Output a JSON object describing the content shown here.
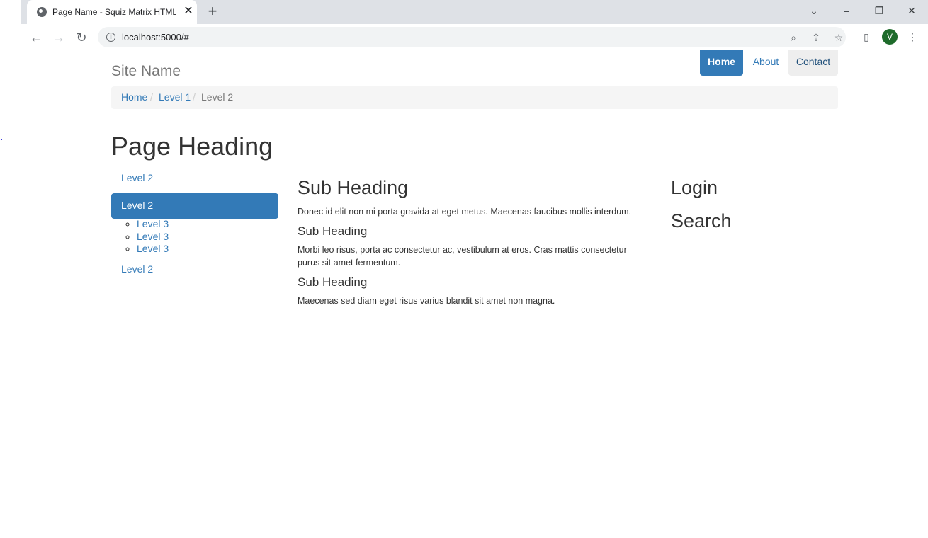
{
  "browser": {
    "tab_title": "Page Name - Squiz Matrix HTML",
    "tab_close": "✕",
    "new_tab": "+",
    "url": "localhost:5000/#",
    "avatar_letter": "V",
    "controls": {
      "dropdown": "⌄",
      "minimize": "–",
      "restore": "❐",
      "close": "✕"
    },
    "icons": {
      "back": "←",
      "forward": "→",
      "reload": "↻",
      "info": "i",
      "zoom": "⌕",
      "share": "⇪",
      "bookmark": "☆",
      "side_panel": "▯",
      "menu": "⋮"
    },
    "avatar_color": "#1e6b2b"
  },
  "site": {
    "name": "Site Name",
    "nav": [
      "Home",
      "About",
      "Contact"
    ]
  },
  "breadcrumb": {
    "items": [
      "Home",
      "Level 1",
      "Level 2"
    ],
    "separator": "/"
  },
  "page": {
    "heading": "Page Heading"
  },
  "sidenav": {
    "items": [
      "Level 2",
      "Level 2",
      "Level 2"
    ],
    "sub_items": [
      "Level 3",
      "Level 3",
      "Level 3"
    ]
  },
  "main": {
    "heading": "Sub Heading",
    "intro": "Donec id elit non mi porta gravida at eget metus. Maecenas faucibus mollis interdum.",
    "sections": [
      {
        "heading": "Sub Heading",
        "text_line1": "Morbi leo risus, porta ac consectetur ac, vestibulum at eros. Cras mattis consectetur",
        "text_line2": "purus sit amet fermentum."
      },
      {
        "heading": "Sub Heading",
        "text_line1": "Maecenas sed diam eget risus varius blandit sit amet non magna."
      }
    ]
  },
  "aside": {
    "login_heading": "Login",
    "search_heading": "Search"
  },
  "colors": {
    "accent": "#337ab7",
    "breadcrumb_bg": "#f5f5f5"
  }
}
